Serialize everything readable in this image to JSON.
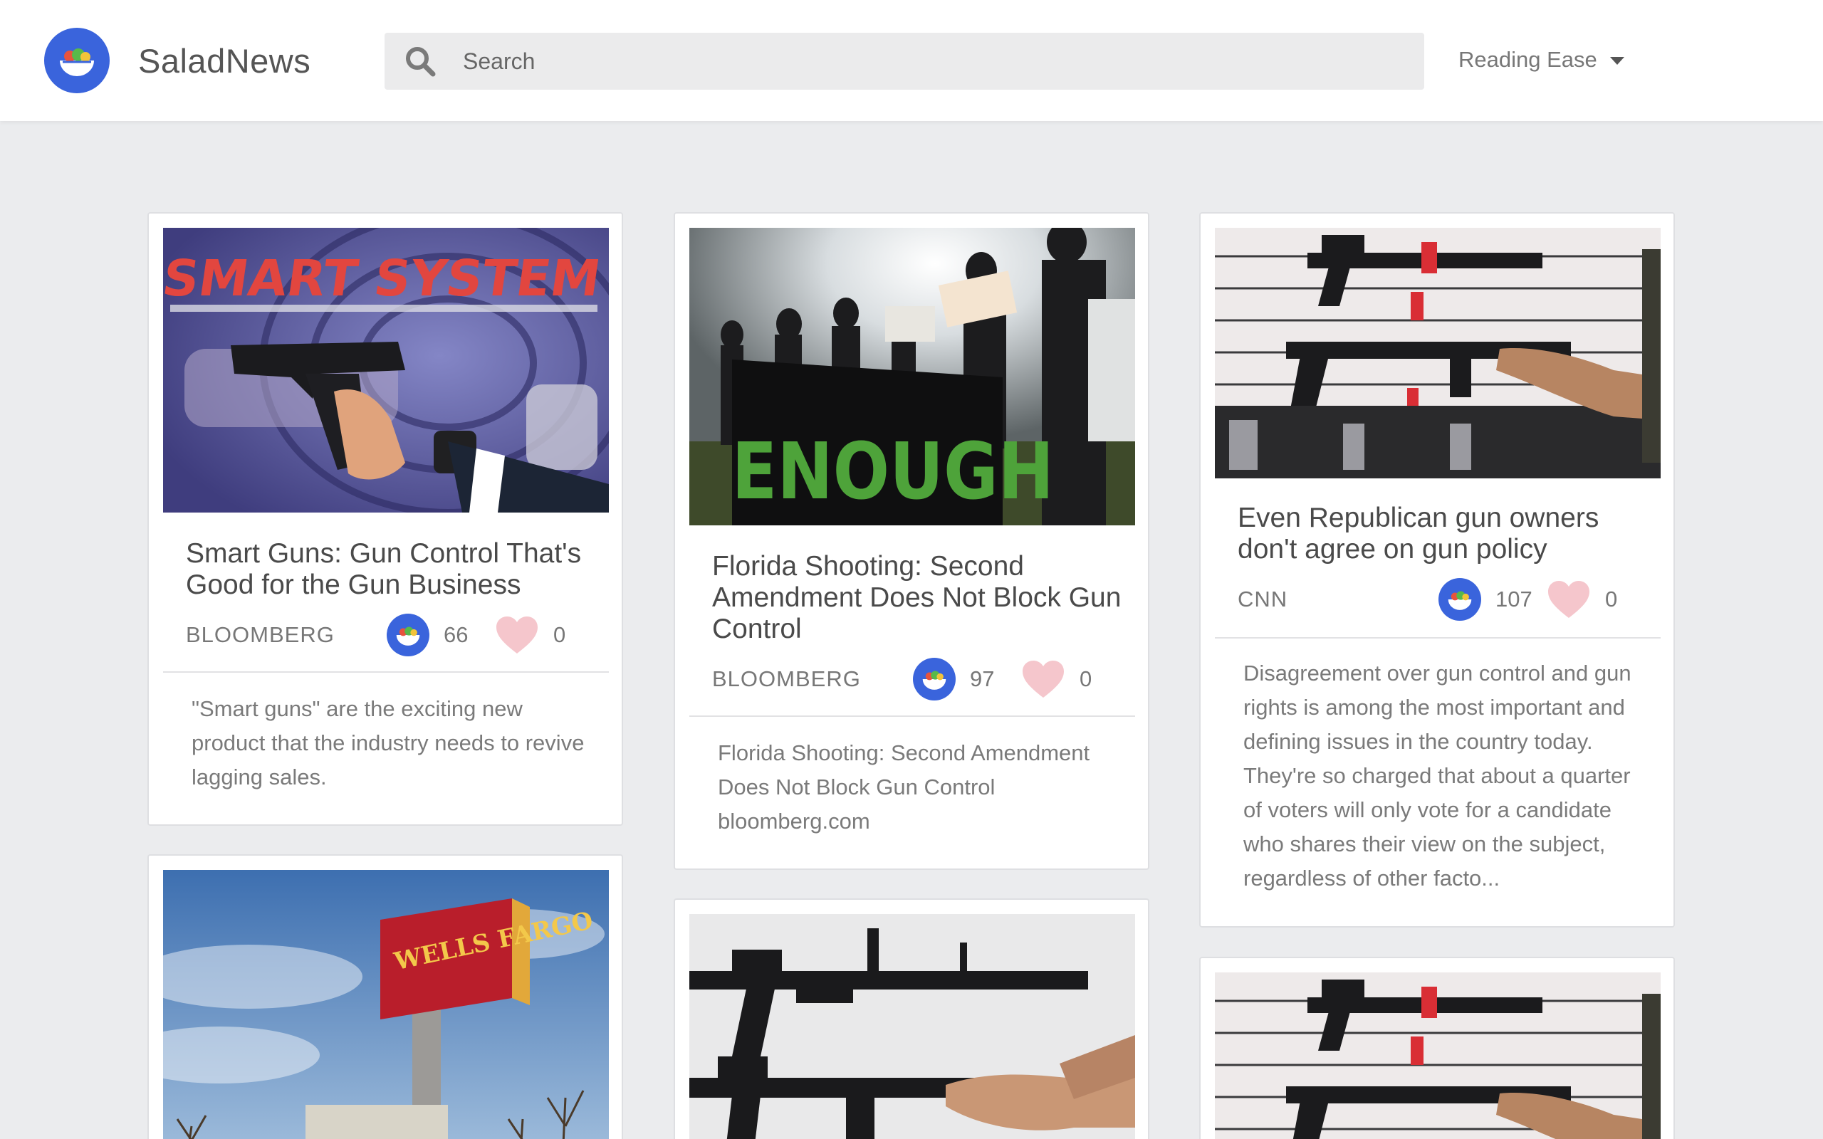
{
  "app": {
    "brand": "SaladNews",
    "search_placeholder": "Search",
    "sort_label": "Reading Ease"
  },
  "articles": [
    {
      "title": "Smart Guns: Gun Control That's Good for the Gun Business",
      "source": "BLOOMBERG",
      "salad_count": "66",
      "likes": "0",
      "excerpt": "\"Smart guns\" are the exciting new product that the industry needs to revive lagging sales."
    },
    {
      "title": "Florida Shooting: Second Amendment Does Not Block Gun Control",
      "source": "BLOOMBERG",
      "salad_count": "97",
      "likes": "0",
      "excerpt": "Florida Shooting: Second Amendment Does Not Block Gun Control bloomberg.com"
    },
    {
      "title": "Even Republican gun owners don't agree on gun policy",
      "source": "CNN",
      "salad_count": "107",
      "likes": "0",
      "excerpt": "Disagreement over gun control and gun rights is among the most important and defining issues in the country today. They're so charged that about a quarter of voters will only vote for a candidate who shares their view on the subject, regardless of other facto..."
    }
  ],
  "images": {
    "smart_system_banner": "SMART SYSTEM",
    "enough_banner": "ENOUGH",
    "wells_fargo_sign": "WELLS FARGO"
  },
  "colors": {
    "accent_blue": "#3a64dc",
    "heart_pink": "#f5c6cc",
    "background": "#ebecee"
  }
}
